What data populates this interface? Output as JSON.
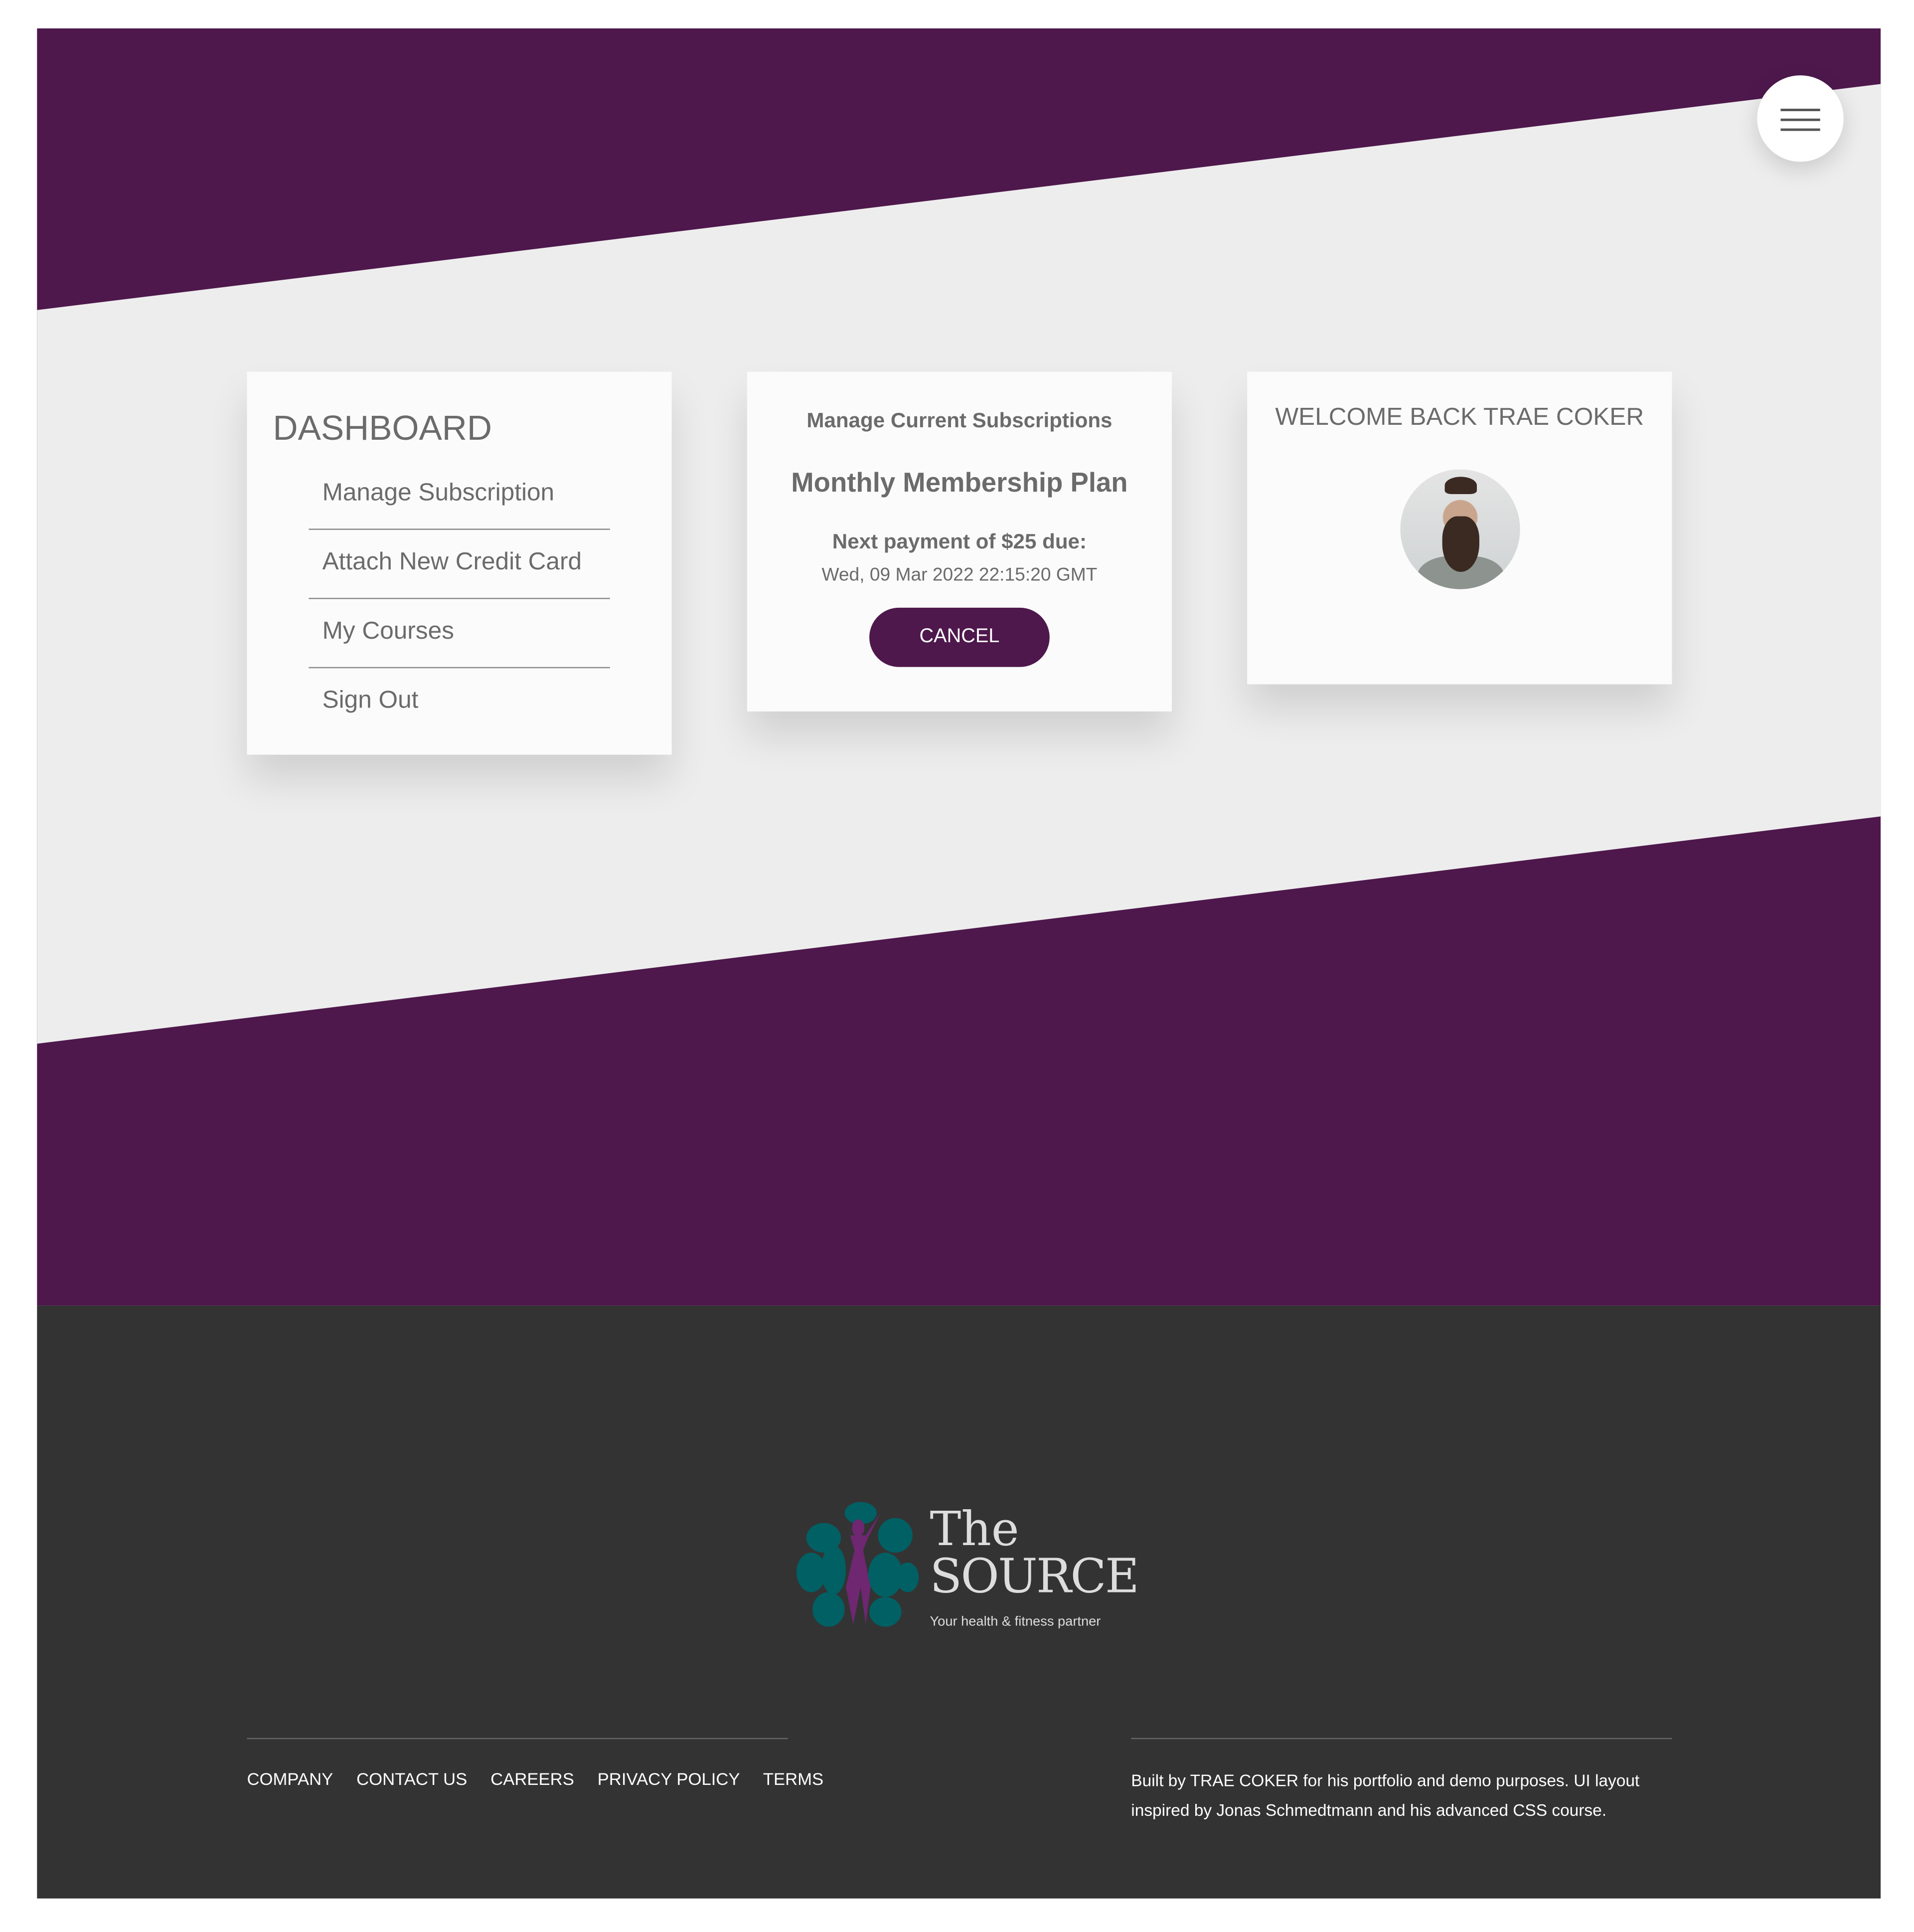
{
  "colors": {
    "brand": "#4e184c",
    "band": "#ededed",
    "footer": "#333333",
    "card": "#fbfbfb"
  },
  "header": {
    "menu_icon": "hamburger-icon"
  },
  "dashboard": {
    "title": "DASHBOARD",
    "items": [
      {
        "label": "Manage Subscription"
      },
      {
        "label": "Attach New Credit Card"
      },
      {
        "label": "My Courses"
      },
      {
        "label": "Sign Out"
      }
    ]
  },
  "subscription": {
    "heading": "Manage Current Subscriptions",
    "plan": "Monthly Membership Plan",
    "next_payment": "Next payment of $25 due:",
    "due_date": "Wed, 09 Mar 2022 22:15:20 GMT",
    "cancel_label": "CANCEL"
  },
  "welcome": {
    "text": "WELCOME BACK TRAE COKER"
  },
  "footer": {
    "logo": {
      "line1": "The",
      "line2": "SOURCE",
      "tagline": "Your health & fitness partner"
    },
    "links": [
      {
        "label": "COMPANY"
      },
      {
        "label": "CONTACT US"
      },
      {
        "label": "CAREERS"
      },
      {
        "label": "PRIVACY POLICY"
      },
      {
        "label": "TERMS"
      }
    ],
    "credit": "Built by TRAE COKER for his portfolio and demo purposes. UI layout inspired by Jonas Schmedtmann and his advanced CSS course."
  }
}
